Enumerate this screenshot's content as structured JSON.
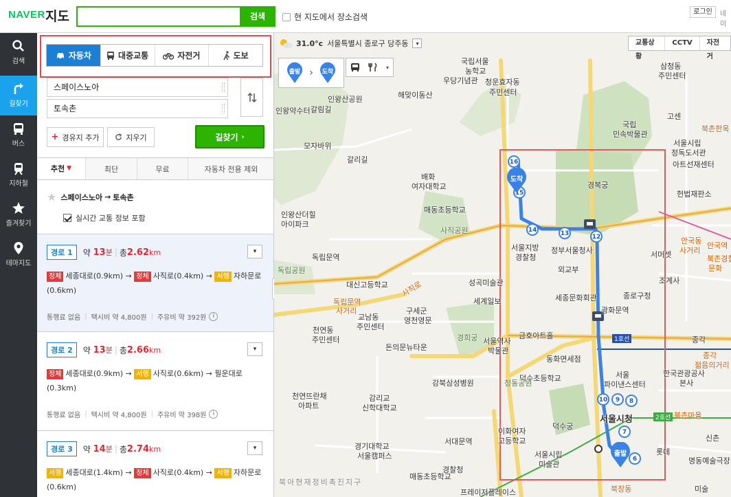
{
  "header": {
    "logo": "NAVER",
    "logo_sub": "지도",
    "search_placeholder": "",
    "search_button": "검색",
    "checkbox_label": "현 지도에서 장소검색",
    "login": "로그인",
    "naver_cut": "네이"
  },
  "leftnav": [
    {
      "label": "검색",
      "icon": "search-icon"
    },
    {
      "label": "길찾기",
      "icon": "directions-icon",
      "active": true
    },
    {
      "label": "버스",
      "icon": "bus-icon"
    },
    {
      "label": "지하철",
      "icon": "subway-icon"
    },
    {
      "label": "즐겨찾기",
      "icon": "star-icon"
    },
    {
      "label": "테마지도",
      "icon": "pin-icon"
    }
  ],
  "modes": [
    {
      "label": "자동차",
      "active": true
    },
    {
      "label": "대중교통"
    },
    {
      "label": "자전거"
    },
    {
      "label": "도보"
    }
  ],
  "waypoints": {
    "start": "스페이스노아",
    "end": "토속촌"
  },
  "buttons": {
    "add_waypoint": "경유지 추가",
    "clear": "지우기",
    "find": "길찾기"
  },
  "opt_tabs": [
    "추천",
    "최단",
    "무료",
    "자동차 전용 제외"
  ],
  "summary": {
    "from": "스페이스노아",
    "arrow": "→",
    "to": "토속촌"
  },
  "traffic_label": "실시간 교통 정보 포함",
  "routes": [
    {
      "label": "경로 1",
      "approx": "약",
      "minutes": "13",
      "min_unit": "분",
      "total": "총",
      "km": "2.62",
      "km_unit": "km",
      "path": [
        {
          "tag": "정체",
          "color": "red",
          "road": "세종대로(0.9km)"
        },
        {
          "tag": "정체",
          "color": "red",
          "road": "사직로(0.4km)"
        },
        {
          "tag": "서행",
          "color": "yel",
          "road": "자하문로(0.6km)"
        }
      ],
      "toll": "통행료 없음",
      "taxi": "택시비 약 4,800원",
      "fuel": "주유비 약 392원"
    },
    {
      "label": "경로 2",
      "approx": "약",
      "minutes": "13",
      "min_unit": "분",
      "total": "총",
      "km": "2.66",
      "km_unit": "km",
      "path": [
        {
          "tag": "정체",
          "color": "red",
          "road": "세종대로(0.9km)"
        },
        {
          "tag": "서행",
          "color": "yel",
          "road": "사직로(0.6km)"
        },
        {
          "tag": "",
          "color": "",
          "road": "필운대로(0.3km)"
        }
      ],
      "toll": "통행료 없음",
      "taxi": "택시비 약 4,800원",
      "fuel": "주유비 약 398원"
    },
    {
      "label": "경로 3",
      "approx": "약",
      "minutes": "14",
      "min_unit": "분",
      "total": "총",
      "km": "2.74",
      "km_unit": "km",
      "path": [
        {
          "tag": "서행",
          "color": "yel",
          "road": "세종대로(1.4km)"
        },
        {
          "tag": "정체",
          "color": "red",
          "road": "사직로(0.4km)"
        },
        {
          "tag": "서행",
          "color": "yel",
          "road": "자하문로(0.6km)"
        }
      ],
      "toll": "",
      "taxi": "",
      "fuel": ""
    }
  ],
  "map": {
    "weather_temp": "31.0°c",
    "weather_loc": "서울특별시 종로구 당주동",
    "buttons": [
      "교통상황",
      "CCTV",
      "자전거"
    ],
    "start_pin": "출발",
    "end_pin": "도착",
    "labels": [
      "국립서울",
      "농학교",
      "우당기념관",
      "청운효자동",
      "주민센터",
      "인왕산공원",
      "해맞이동산",
      "인왕약수터",
      "갈림길",
      "모자바위",
      "갈리길",
      "배화",
      "여자대학교",
      "매동초등학교",
      "사직공원",
      "인왕산더힐",
      "아이파크",
      "독립문역",
      "독립공원",
      "대신고등학교",
      "사직로",
      "독립문역",
      "사거리",
      "교남동",
      "주민센터",
      "구세군",
      "영천영문",
      "성곡미술관",
      "세계일보",
      "천연동",
      "주민센터",
      "돈의문뉴타운",
      "경희궁",
      "서울역사",
      "박물관",
      "금호아트홀",
      "동화면세점",
      "강북삼성병원",
      "감리교",
      "신학대학교",
      "천연뜨란채",
      "아파트",
      "서대문역",
      "경기대학교",
      "서울캠퍼스",
      "이화여자",
      "고등학교",
      "정동공원",
      "덕수초등학교",
      "덕수궁",
      "서울시립",
      "미술관",
      "매동초등학교",
      "경찰청",
      "북아현재정비촉진지구",
      "프레이저플레이스",
      "국립",
      "민속박물관",
      "경복궁",
      "서울지방",
      "경찰청",
      "정부서울청사",
      "외교부",
      "세종문화회관",
      "종로구청",
      "서울시청",
      "서울",
      "파이낸스센터",
      "한국관광공사",
      "본사",
      "종각",
      "종각",
      "젊음의거리",
      "서울시립",
      "정독도서관",
      "아트선재센터",
      "삼청동",
      "주민센터",
      "고센",
      "북촌한옥",
      "헌법재판소",
      "안국동",
      "사거리",
      "안국역",
      "서머셋",
      "조계사",
      "북촌경찰",
      "문화",
      "명동예술극장",
      "롯데",
      "북촌마을",
      "광화문역",
      "1호선",
      "2호선",
      "신촌",
      "북장동",
      "미술"
    ]
  }
}
